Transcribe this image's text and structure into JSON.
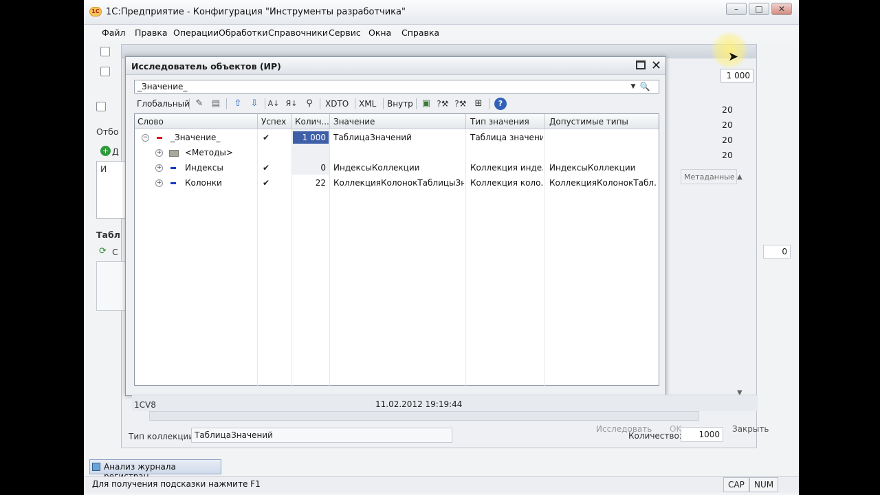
{
  "window": {
    "title": "1С:Предприятие - Конфигурация \"Инструменты разработчика\"",
    "min": "–",
    "max": "□",
    "close": "✕"
  },
  "menu": [
    "Файл",
    "Правка",
    "Операции",
    "Обработки",
    "Справочники",
    "Сервис",
    "Окна",
    "Справка"
  ],
  "background": {
    "left_labels": [
      "Отбо",
      "Д",
      "И",
      "Табл",
      "С"
    ],
    "right_values": [
      "1 000",
      "20",
      "20",
      "20",
      "20"
    ],
    "right_header": "Метаданные",
    "right_zero": "0",
    "row_text": "1CV8",
    "timestamp": "11.02.2012 19:19:44",
    "type_label": "Тип коллекции:",
    "type_value": "ТаблицаЗначений",
    "explore_button": "Исследовать",
    "ok_label": "OK",
    "qty_label": "Количество:",
    "qty_value": "1000",
    "close_button": "Закрыть"
  },
  "dialog": {
    "title": "Исследователь объектов (ИР)",
    "search_value": "_Значение_",
    "toolbar": {
      "global": "Глобальный",
      "xdto": "XDTO",
      "xml": "XML",
      "internal": "Внутр"
    },
    "columns": [
      "Слово",
      "Успех",
      "Колич...",
      "Значение",
      "Тип значения",
      "Допустимые типы"
    ],
    "rows": [
      {
        "word": "_Значение_",
        "success": "✔",
        "count": "1 000",
        "value": "ТаблицаЗначений",
        "type": "Таблица значений",
        "allowed": ""
      },
      {
        "word": "<Методы>",
        "success": "",
        "count": "",
        "value": "",
        "type": "",
        "allowed": ""
      },
      {
        "word": "Индексы",
        "success": "✔",
        "count": "0",
        "value": "ИндексыКоллекции",
        "type": "Коллекция инде...",
        "allowed": "ИндексыКоллекции"
      },
      {
        "word": "Колонки",
        "success": "✔",
        "count": "22",
        "value": "КоллекцияКолонокТаблицыЗн...",
        "type": "Коллекция коло...",
        "allowed": "КоллекцияКолонокТабл..."
      }
    ]
  },
  "taskbar": {
    "item": "Анализ журнала регистрац..."
  },
  "status": {
    "hint": "Для получения подсказки нажмите F1",
    "cap": "CAP",
    "num": "NUM"
  }
}
